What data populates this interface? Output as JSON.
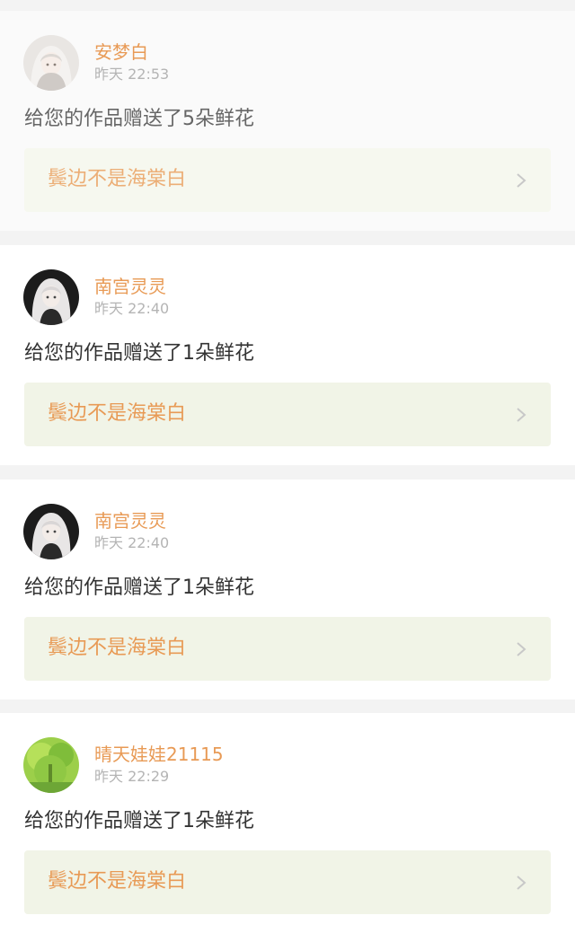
{
  "notifications": [
    {
      "username": "安梦白",
      "time": "昨天 22:53",
      "message": "给您的作品赠送了5朵鲜花",
      "work_title": "鬓边不是海棠白",
      "avatar_icon": "anime-avatar-white-hair-icon"
    },
    {
      "username": "南宫灵灵",
      "time": "昨天 22:40",
      "message": "给您的作品赠送了1朵鲜花",
      "work_title": "鬓边不是海棠白",
      "avatar_icon": "anime-avatar-dark-icon"
    },
    {
      "username": "南宫灵灵",
      "time": "昨天 22:40",
      "message": "给您的作品赠送了1朵鲜花",
      "work_title": "鬓边不是海棠白",
      "avatar_icon": "anime-avatar-dark-icon"
    },
    {
      "username": "晴天娃娃21115",
      "time": "昨天 22:29",
      "message": "给您的作品赠送了1朵鲜花",
      "work_title": "鬓边不是海棠白",
      "avatar_icon": "green-tree-avatar-icon"
    }
  ],
  "colors": {
    "accent": "#e89a55",
    "card_link_bg": "#f1f4e7",
    "timestamp": "#b4b4b4",
    "page_bg": "#f3f3f3"
  }
}
